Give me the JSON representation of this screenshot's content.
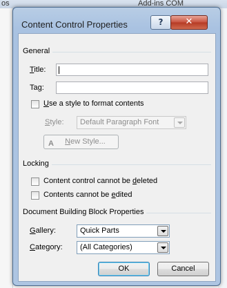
{
  "background": {
    "top_left_text": "os",
    "top_right_text": "Add-ins  COM"
  },
  "dialog": {
    "title": "Content Control Properties",
    "help_label": "?",
    "close_label": "✕"
  },
  "general": {
    "section_label": "General",
    "title_label_u": "T",
    "title_label_rest": "itle:",
    "title_value": "",
    "tag_label_pre": "Ta",
    "tag_label_u": "g",
    "tag_label_post": ":",
    "tag_value": "",
    "use_style_u": "U",
    "use_style_rest": "se a style to format contents",
    "use_style_checked": false,
    "style_label_u": "S",
    "style_label_rest": "tyle:",
    "style_value": "Default Paragraph Font",
    "new_style_u": "N",
    "new_style_rest": "ew Style..."
  },
  "locking": {
    "section_label": "Locking",
    "cannot_delete_pre": "Content control cannot be ",
    "cannot_delete_u": "d",
    "cannot_delete_post": "eleted",
    "cannot_delete_checked": false,
    "cannot_edit_pre": "Contents cannot be ",
    "cannot_edit_u": "e",
    "cannot_edit_post": "dited",
    "cannot_edit_checked": false
  },
  "building_block": {
    "section_label": "Document Building Block Properties",
    "gallery_label_u": "G",
    "gallery_label_rest": "allery:",
    "gallery_value": "Quick Parts",
    "category_label_u": "C",
    "category_label_rest": "ategory:",
    "category_value": "(All Categories)"
  },
  "buttons": {
    "ok_label": "OK",
    "cancel_label": "Cancel"
  },
  "colors": {
    "frame_accent": "#a9c2e1",
    "close_button": "#c7503c",
    "client_background": "#f0f0f0"
  }
}
